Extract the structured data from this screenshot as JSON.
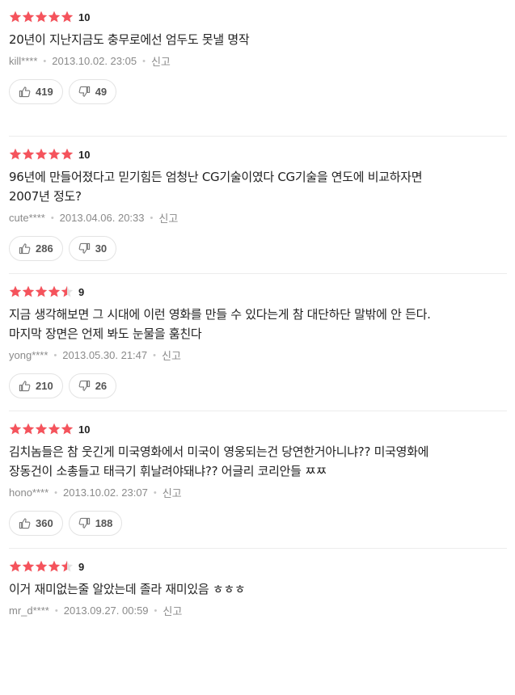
{
  "colors": {
    "star_fill": "#f5535c",
    "star_empty": "#e2e2e2",
    "meta_text": "#8a8a8a"
  },
  "reviews": [
    {
      "rating": 10,
      "rating_label": "10",
      "lines": [
        "20년이 지난지금도 충무로에선 엄두도 못낼 명작"
      ],
      "user": "kill****",
      "date": "2013.10.02. 23:05",
      "report_label": "신고",
      "likes": "419",
      "dislikes": "49",
      "like_icon": "thumbs-up-icon",
      "dislike_icon": "thumbs-down-icon"
    },
    {
      "rating": 10,
      "rating_label": "10",
      "lines": [
        "96년에 만들어졌다고 믿기힘든 엄청난 CG기술이였다 CG기술을 연도에 비교하자면",
        "2007년 정도?"
      ],
      "user": "cute****",
      "date": "2013.04.06. 20:33",
      "report_label": "신고",
      "likes": "286",
      "dislikes": "30",
      "like_icon": "thumbs-up-icon",
      "dislike_icon": "thumbs-down-icon"
    },
    {
      "rating": 9,
      "rating_label": "9",
      "lines": [
        "지금 생각해보면 그 시대에 이런 영화를 만들 수 있다는게 참 대단하단 말밖에 안 든다.",
        "마지막 장면은 언제 봐도 눈물을 훔친다"
      ],
      "user": "yong****",
      "date": "2013.05.30. 21:47",
      "report_label": "신고",
      "likes": "210",
      "dislikes": "26",
      "like_icon": "thumbs-up-icon",
      "dislike_icon": "thumbs-down-icon"
    },
    {
      "rating": 10,
      "rating_label": "10",
      "lines": [
        "김치놈들은 참 웃긴게 미국영화에서 미국이 영웅되는건 당연한거아니냐?? 미국영화에",
        "장동건이 소총들고 태극기 휘날려야돼냐?? 어글리 코리안들 ㅉㅉ"
      ],
      "user": "hono****",
      "date": "2013.10.02. 23:07",
      "report_label": "신고",
      "likes": "360",
      "dislikes": "188",
      "like_icon": "thumbs-up-icon",
      "dislike_icon": "thumbs-down-icon"
    },
    {
      "rating": 9,
      "rating_label": "9",
      "lines": [
        "이거 재미없는줄 알았는데 졸라 재미있음 ㅎㅎㅎ"
      ],
      "user": "mr_d****",
      "date": "2013.09.27. 00:59",
      "report_label": "신고",
      "likes": "",
      "dislikes": "",
      "like_icon": "thumbs-up-icon",
      "dislike_icon": "thumbs-down-icon"
    }
  ]
}
